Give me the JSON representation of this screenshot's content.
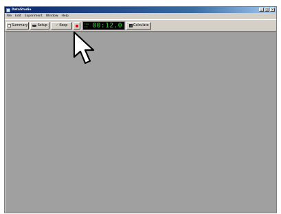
{
  "window": {
    "title": "DataStudio",
    "controls": [
      "_",
      "□",
      "×"
    ]
  },
  "menubar": {
    "items": [
      "File",
      "Edit",
      "Experiment",
      "Window",
      "Help"
    ]
  },
  "toolbar": {
    "summary_label": "Summary",
    "setup_label": "Setup",
    "keep_label": "Keep",
    "record_color": "#e00000",
    "calculate_label": "Calculate"
  },
  "timer": {
    "label_top": "Time",
    "label_bottom": "min",
    "value": "00:12.0",
    "digit_color": "#2ee02e"
  },
  "icons": {
    "summary": "summary-icon",
    "setup": "setup-icon",
    "keep": "checkmark-icon",
    "record": "record-icon",
    "calculate": "calculator-icon",
    "cursor": "mouse-cursor-icon"
  },
  "colors": {
    "titlebar": "#0a246a",
    "chrome": "#d4d0c8",
    "workspace": "#a0a0a0"
  }
}
